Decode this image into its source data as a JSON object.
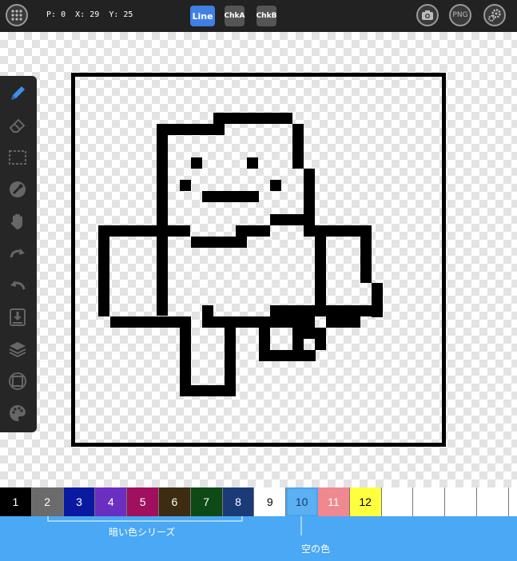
{
  "status": {
    "p_label": "P:",
    "p_value": "0",
    "x_label": "X:",
    "x_value": "29",
    "y_label": "Y:",
    "y_value": "25"
  },
  "modes": [
    {
      "label": "Line",
      "active": true
    },
    {
      "label": "ChkA",
      "active": false
    },
    {
      "label": "ChkB",
      "active": false
    }
  ],
  "right_buttons": {
    "camera_icon": "camera-icon",
    "png_label": "PNG",
    "settings_icon": "gears-icon"
  },
  "tools": [
    "pencil-icon",
    "eraser-icon",
    "select-rect-icon",
    "eyedropper-icon",
    "hand-icon",
    "redo-icon",
    "undo-icon",
    "import-icon",
    "layers-icon",
    "frame-icon",
    "palette-icon"
  ],
  "palette": [
    {
      "label": "1",
      "color": "#000000",
      "text": "#ffffff"
    },
    {
      "label": "2",
      "color": "#6b6b6b",
      "text": "#ffffff"
    },
    {
      "label": "3",
      "color": "#0a1aa0",
      "text": "#ffffff"
    },
    {
      "label": "4",
      "color": "#6a2fc0",
      "text": "#ffffff"
    },
    {
      "label": "5",
      "color": "#a0105e",
      "text": "#ffffff"
    },
    {
      "label": "6",
      "color": "#3d2b12",
      "text": "#ffffff"
    },
    {
      "label": "7",
      "color": "#0e4a16",
      "text": "#ffffff"
    },
    {
      "label": "8",
      "color": "#1b3b78",
      "text": "#ffffff"
    },
    {
      "label": "9",
      "color": "#ffffff",
      "text": "#000000"
    },
    {
      "label": "10",
      "color": "#5ab0f0",
      "text": "#1a3a70"
    },
    {
      "label": "11",
      "color": "#f08890",
      "text": "#ffffff"
    },
    {
      "label": "12",
      "color": "#ffff40",
      "text": "#000000"
    },
    {
      "label": "",
      "color": "transparent",
      "text": "#000"
    },
    {
      "label": "",
      "color": "transparent",
      "text": "#000"
    },
    {
      "label": "",
      "color": "transparent",
      "text": "#000"
    },
    {
      "label": "",
      "color": "transparent",
      "text": "#000"
    }
  ],
  "selected_color_index": 9,
  "hints": {
    "dark_series": "暗い色シリーズ",
    "empty_color": "空の色"
  },
  "accent": "#3f7fe6"
}
